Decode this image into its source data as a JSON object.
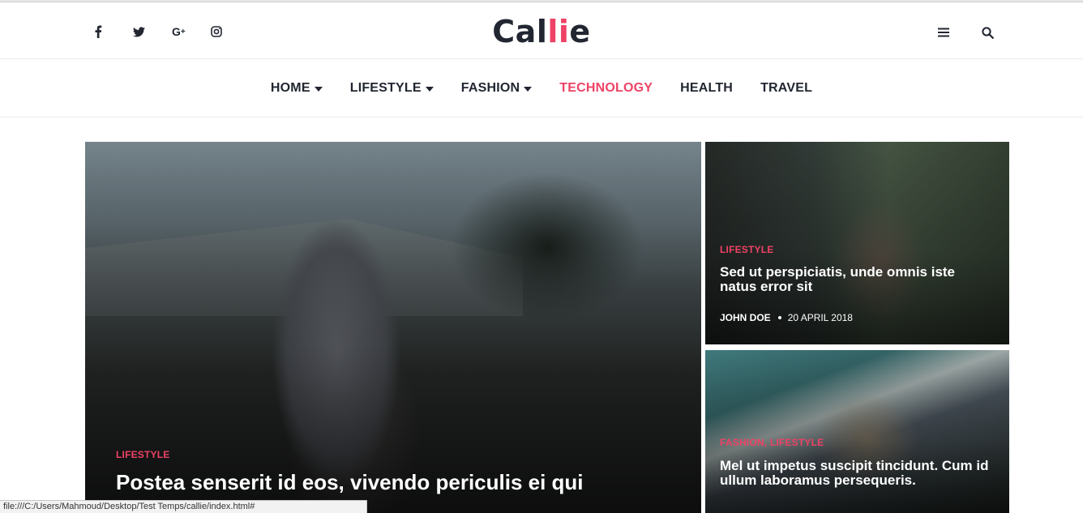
{
  "brand": {
    "logo_main": "Cal",
    "logo_accent": "li",
    "logo_end": "e",
    "accent_color": "#ee4266"
  },
  "social": [
    {
      "icon": "facebook-icon",
      "glyph": "f"
    },
    {
      "icon": "twitter-icon",
      "glyph": "🐦"
    },
    {
      "icon": "google-plus-icon",
      "glyph": "G+"
    },
    {
      "icon": "instagram-icon",
      "glyph": "◎"
    }
  ],
  "header_actions": [
    {
      "icon": "menu-icon"
    },
    {
      "icon": "search-icon"
    }
  ],
  "nav": {
    "items": [
      {
        "label": "HOME",
        "dropdown": true,
        "active": false
      },
      {
        "label": "LIFESTYLE",
        "dropdown": true,
        "active": false
      },
      {
        "label": "FASHION",
        "dropdown": true,
        "active": false
      },
      {
        "label": "TECHNOLOGY",
        "dropdown": false,
        "active": true
      },
      {
        "label": "HEALTH",
        "dropdown": false,
        "active": false
      },
      {
        "label": "TRAVEL",
        "dropdown": false,
        "active": false
      }
    ]
  },
  "posts": {
    "main": {
      "category": "LIFESTYLE",
      "title": "Postea senserit id eos, vivendo periculis ei qui"
    },
    "side_a": {
      "category": "LIFESTYLE",
      "title": "Sed ut perspiciatis, unde omnis iste natus error sit",
      "author": "JOHN DOE",
      "date": "20 APRIL 2018"
    },
    "side_b": {
      "category_1": "FASHION",
      "category_2": "LIFESTYLE",
      "separator": ", ",
      "title": "Mel ut impetus suscipit tincidunt. Cum id ullum laboramus persequeris."
    }
  },
  "status_bar": {
    "url": "file:///C:/Users/Mahmoud/Desktop/Test Temps/callie/index.html#"
  }
}
